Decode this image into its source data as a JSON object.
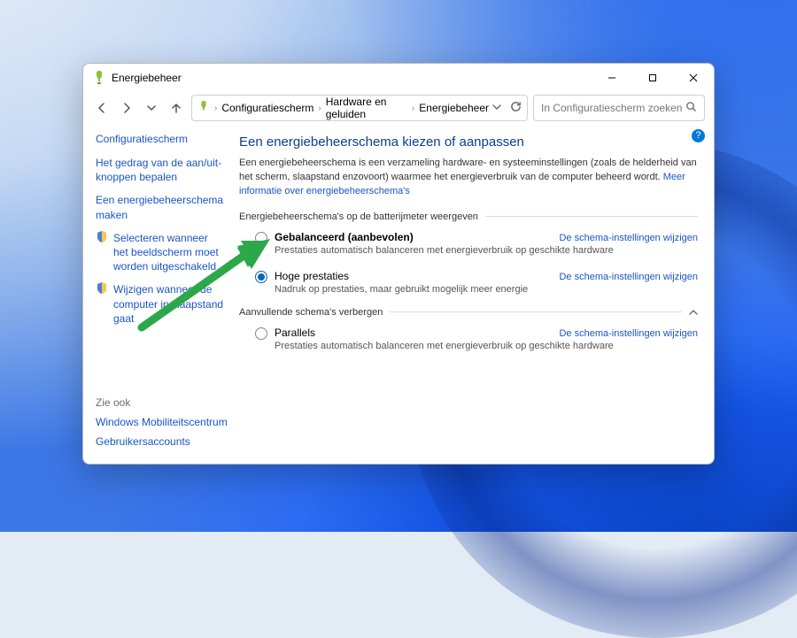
{
  "colors": {
    "accent": "#0078d4",
    "link": "#1a54c5",
    "title": "#0b3d91",
    "arrow": "#2ba84a"
  },
  "titlebar": {
    "title": "Energiebeheer"
  },
  "breadcrumb": {
    "items": [
      "Configuratiescherm",
      "Hardware en geluiden",
      "Energiebeheer"
    ]
  },
  "search": {
    "placeholder": "In Configuratiescherm zoeken"
  },
  "sidebar": {
    "home": "Configuratiescherm",
    "items": [
      {
        "id": "wake-buttons",
        "label": "Het gedrag van de aan/uit-knoppen bepalen",
        "icon": null
      },
      {
        "id": "create-plan",
        "label": "Een energiebeheerschema maken",
        "icon": null
      },
      {
        "id": "display-off",
        "label": "Selecteren wanneer het beeldscherm moet worden uitgeschakeld",
        "icon": "monitor"
      },
      {
        "id": "sleep",
        "label": "Wijzigen wanneer de computer in slaapstand gaat",
        "icon": "moon"
      }
    ]
  },
  "main": {
    "title": "Een energiebeheerschema kiezen of aanpassen",
    "description_pre": "Een energiebeheerschema is een verzameling hardware- en systeeminstellingen (zoals de helderheid van het scherm, slaapstand enzovoort) waarmee het energieverbruik van de computer beheerd wordt. ",
    "description_link": "Meer informatie over energiebeheerschema's",
    "group1_header": "Energiebeheerschema's op de batterijmeter weergeven",
    "group2_header": "Aanvullende schema's verbergen",
    "change_label": "De schema-instellingen wijzigen",
    "plans": {
      "balanced": {
        "name": "Gebalanceerd (aanbevolen)",
        "sub": "Prestaties automatisch balanceren met energieverbruik op geschikte hardware",
        "selected": false
      },
      "high": {
        "name": "Hoge prestaties",
        "sub": "Nadruk op prestaties, maar gebruikt mogelijk meer energie",
        "selected": true
      },
      "parallels": {
        "name": "Parallels",
        "sub": "Prestaties automatisch balanceren met energieverbruik op geschikte hardware",
        "selected": false
      }
    }
  },
  "seealso": {
    "header": "Zie ook",
    "items": [
      "Windows Mobiliteitscentrum",
      "Gebruikersaccounts"
    ]
  },
  "help_tooltip": "?"
}
